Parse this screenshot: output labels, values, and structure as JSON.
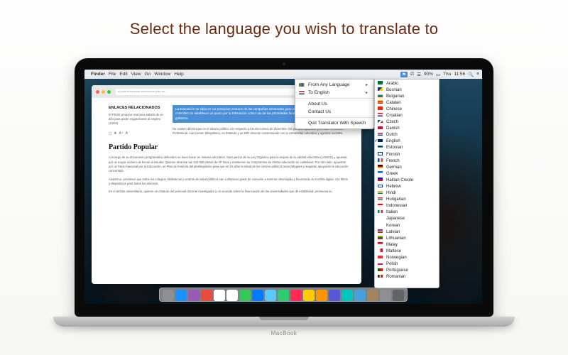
{
  "headline": "Select the language you wish to translate to",
  "menubar": {
    "apple": "",
    "items": [
      "Finder",
      "File",
      "Edit",
      "View",
      "Go",
      "Window",
      "Help"
    ],
    "battery": "90%",
    "day": "Thu",
    "time": "11:56"
  },
  "browser": {
    "url": "el-pais-educacion-elecciones-pide-se...",
    "relHeading": "ENLACES RELACIONADOS",
    "rel1": "El PSOE propone una beca-salario de un año para poder engancharse al empleo (24/04)",
    "highlighted": "La Educación se sitúa en los principios rectores de las campañas electorales para el 26-J. Todos los grupos políticos coinciden en establecer un pacto por la Educación como una de las prioridades fundamentales para crear un nuevo gobierno.",
    "para1": "No existen diferencias en el ideario político con respecto a las elecciones de diciembre: los partidos apuestan por más Formación Profesional, más becas, bilingüismo, un Estatuto y un MIR docente consensuado con la comunidad educativa y agentes sociales.",
    "h2": "Partido Popular",
    "para2": "A lo largo de su documento programático defienden su buen hacer en materia educativa. Saca pecho de su Ley Orgánica para la mejora de la calidad educativa (LOMCE) y apuesta por un mayor número de becas al estudio. Quieren alcanzar las 100.000 plazas de FP Dual y mantienen su compromiso de ofertar educación en castellano. Por otro lado, apuestan por un Pacto Nacional por la Educación, un Plan de fomento del plurilingüismo para que en 10 años la mitad de los centros públicos sean bilingües y seguirán apoyando la educación concertada.",
    "para3": "Asimismo, prometen que todos los colegios, bibliotecas y centros de salud públicos van a disponer gratis de conexión a Internet ultrarrápida y financiarán la mochila digital, con libros y dispositivos para todos los alumnos.",
    "para4": "En el ámbito universitario, quieren un estatuto del personal docente investigador y un acuerdo sobre la financiación de las universidades que dé estabilidad, promueva su"
  },
  "appmenu": {
    "fromAny": "From Any Language",
    "toEnglish": "To English",
    "about": "About Us",
    "contact": "Contact Us",
    "quit": "Quit Translator With Speech"
  },
  "languages": [
    {
      "label": "Arabic",
      "flag": "f-sa"
    },
    {
      "label": "Bosnian",
      "flag": "f-ba"
    },
    {
      "label": "Bulgarian",
      "flag": "f-bg"
    },
    {
      "label": "Catalan",
      "flag": "f-ca"
    },
    {
      "label": "Chinese",
      "flag": "f-cn"
    },
    {
      "label": "Croatian",
      "flag": "f-hr"
    },
    {
      "label": "Czech",
      "flag": "f-cz"
    },
    {
      "label": "Danish",
      "flag": "f-dk"
    },
    {
      "label": "Dutch",
      "flag": "f-nl"
    },
    {
      "label": "English",
      "flag": "f-gb",
      "checked": true
    },
    {
      "label": "Estonian",
      "flag": "f-ee"
    },
    {
      "label": "Finnish",
      "flag": "f-fi"
    },
    {
      "label": "French",
      "flag": "f-fr"
    },
    {
      "label": "German",
      "flag": "f-de"
    },
    {
      "label": "Greek",
      "flag": "f-gr"
    },
    {
      "label": "Haitian Creole",
      "flag": "f-ht"
    },
    {
      "label": "Hebrew",
      "flag": "f-il"
    },
    {
      "label": "Hindi",
      "flag": "f-in"
    },
    {
      "label": "Hungarian",
      "flag": "f-hu"
    },
    {
      "label": "Indonesian",
      "flag": "f-id"
    },
    {
      "label": "Italian",
      "flag": "f-it"
    },
    {
      "label": "Japanese",
      "flag": "f-jp"
    },
    {
      "label": "Korean",
      "flag": "f-kr"
    },
    {
      "label": "Latvian",
      "flag": "f-lv"
    },
    {
      "label": "Lithuanian",
      "flag": "f-lt"
    },
    {
      "label": "Malay",
      "flag": "f-my"
    },
    {
      "label": "Maltese",
      "flag": "f-mt"
    },
    {
      "label": "Norwegian",
      "flag": "f-no"
    },
    {
      "label": "Polish",
      "flag": "f-pl"
    },
    {
      "label": "Portuguese",
      "flag": "f-pt"
    },
    {
      "label": "Romanian",
      "flag": "f-ro"
    }
  ],
  "dock_colors": [
    "#8e8e93",
    "#1e90ff",
    "#9b59b6",
    "#e74c3c",
    "#ffffff",
    "#ffffff",
    "#34c759",
    "#007aff",
    "#5ac8fa",
    "#2ecc71",
    "#ff2d55",
    "#ffcc00",
    "#ff9500",
    "#5856d6",
    "#00c7be",
    "#48a0dc",
    "#a2845e",
    "#8e8e93",
    "#636366"
  ],
  "brand": "MacBook"
}
